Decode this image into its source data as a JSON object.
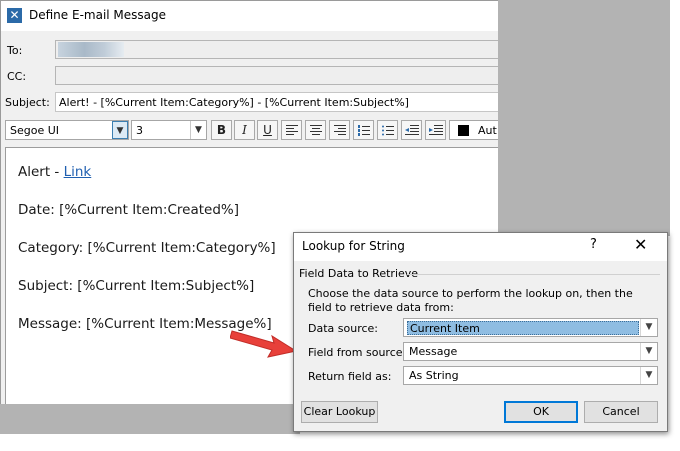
{
  "window": {
    "title": "Define E-mail Message"
  },
  "fields": {
    "to_label": "To:",
    "cc_label": "CC:",
    "subject_label": "Subject:",
    "subject_value": "Alert! - [%Current Item:Category%] - [%Current Item:Subject%]"
  },
  "toolbar": {
    "font": "Segoe UI",
    "size": "3",
    "bold": "B",
    "italic": "I",
    "underline": "U",
    "color_label": "Aut"
  },
  "editor": {
    "alert_prefix": "Alert - ",
    "alert_link": "Link",
    "line_date": "Date: [%Current Item:Created%]",
    "line_category": "Category: [%Current Item:Category%]",
    "line_subject": "Subject: [%Current Item:Subject%]",
    "line_message": "Message: [%Current Item:Message%]"
  },
  "dialog": {
    "title": "Lookup for String",
    "help": "?",
    "close": "✕",
    "group_label": "Field Data to Retrieve",
    "description": "Choose the data source to perform the lookup on, then the field to retrieve data from:",
    "data_source_label": "Data source:",
    "data_source_value": "Current Item",
    "field_label": "Field from source:",
    "field_value": "Message",
    "return_label": "Return field as:",
    "return_value": "As String",
    "clear_button": "Clear Lookup",
    "ok_button": "OK",
    "cancel_button": "Cancel"
  },
  "colors": {
    "accent": "#0078d7",
    "link": "#1f5fb0",
    "arrow": "#e8403a",
    "selection": "#8fbde2"
  }
}
